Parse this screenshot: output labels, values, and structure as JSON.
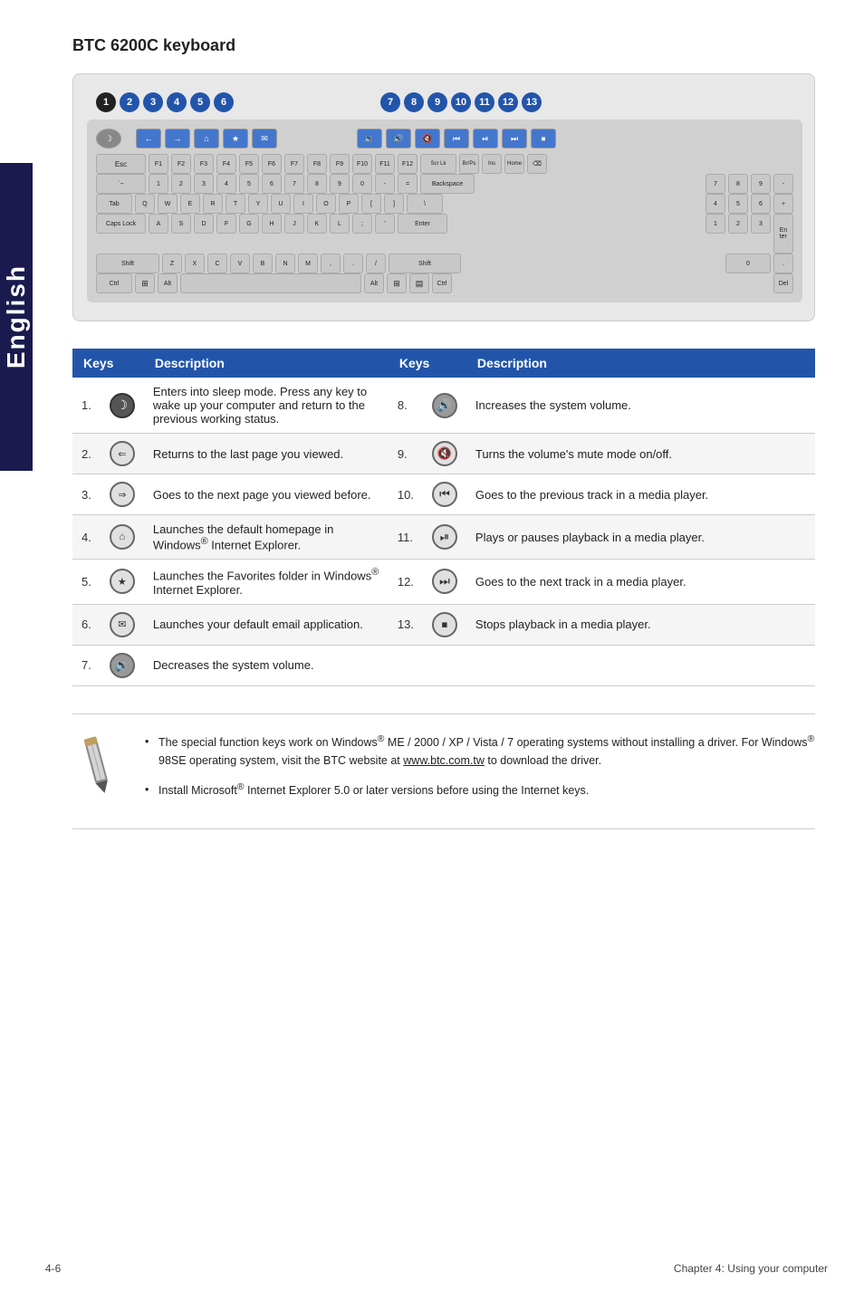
{
  "page": {
    "title": "BTC 6200C keyboard"
  },
  "sidetab": {
    "text": "English"
  },
  "number_labels_group1": [
    "1",
    "2",
    "3",
    "4",
    "5",
    "6"
  ],
  "number_labels_group2": [
    "7",
    "8",
    "9",
    "10",
    "11",
    "12",
    "13"
  ],
  "table": {
    "col1_header": "Keys",
    "col2_header": "Description",
    "col3_header": "Keys",
    "col4_header": "Description",
    "rows": [
      {
        "num_left": "1.",
        "icon_left": "sleep",
        "desc_left": "Enters into sleep mode. Press any key to wake up your computer and return to the previous working status.",
        "num_right": "8.",
        "icon_right": "volup",
        "desc_right": "Increases the system volume."
      },
      {
        "num_left": "2.",
        "icon_left": "back",
        "desc_left": "Returns to the last page you viewed.",
        "num_right": "9.",
        "icon_right": "mute",
        "desc_right": "Turns the volume's mute mode on/off."
      },
      {
        "num_left": "3.",
        "icon_left": "fwd",
        "desc_left": "Goes to the next page you viewed before.",
        "num_right": "10.",
        "icon_right": "prevtrack",
        "desc_right": "Goes to the previous track in a media player."
      },
      {
        "num_left": "4.",
        "icon_left": "home",
        "desc_left": "Launches the default homepage in Windows® Internet Explorer.",
        "num_right": "11.",
        "icon_right": "playpause",
        "desc_right": "Plays or pauses playback in a media player."
      },
      {
        "num_left": "5.",
        "icon_left": "fav",
        "desc_left": "Launches the Favorites folder in Windows® Internet Explorer.",
        "num_right": "12.",
        "icon_right": "nexttrack",
        "desc_right": "Goes to the next track in a media player."
      },
      {
        "num_left": "6.",
        "icon_left": "mail",
        "desc_left": "Launches your default email application.",
        "num_right": "13.",
        "icon_right": "stop",
        "desc_right": "Stops playback in a media player."
      },
      {
        "num_left": "7.",
        "icon_left": "voldown",
        "desc_left": "Decreases the system volume.",
        "num_right": "",
        "icon_right": "",
        "desc_right": ""
      }
    ]
  },
  "notes": [
    "The special function keys work on Windows® ME / 2000 / XP / Vista / 7 operating systems without installing a driver. For Windows® 98SE operating system, visit the BTC website at www.btc.com.tw to download the driver.",
    "Install Microsoft® Internet Explorer 5.0 or later versions before using the Internet keys."
  ],
  "footer": {
    "left": "4-6",
    "right": "Chapter 4: Using your computer"
  }
}
